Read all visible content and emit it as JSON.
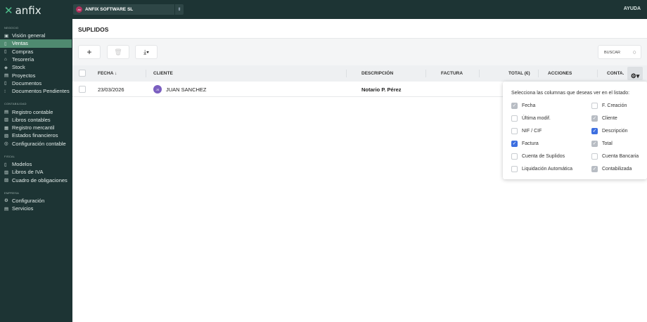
{
  "app": {
    "logo": "anfix",
    "company": "ANFIX SOFTWARE SL",
    "company_initials": "AS",
    "help": "AYUDA"
  },
  "sidebar": {
    "sections": [
      {
        "label": "NEGOCIO",
        "items": [
          {
            "label": "Visión general",
            "icon": "chart-icon"
          },
          {
            "label": "Ventas",
            "icon": "document-icon",
            "active": true
          },
          {
            "label": "Compras",
            "icon": "document-icon"
          },
          {
            "label": "Tesorería",
            "icon": "bank-icon"
          },
          {
            "label": "Stock",
            "icon": "box-icon"
          },
          {
            "label": "Proyectos",
            "icon": "folder-icon"
          },
          {
            "label": "Documentos",
            "icon": "file-icon"
          },
          {
            "label": "Documentos Pendientes",
            "icon": "scan-icon"
          }
        ]
      },
      {
        "label": "CONTABILIDAD",
        "items": [
          {
            "label": "Registro contable",
            "icon": "ledger-icon"
          },
          {
            "label": "Libros contables",
            "icon": "book-icon"
          },
          {
            "label": "Registro mercantil",
            "icon": "registry-icon"
          },
          {
            "label": "Estados financieros",
            "icon": "report-icon"
          },
          {
            "label": "Configuración contable",
            "icon": "settings-icon"
          }
        ]
      },
      {
        "label": "FISCAL",
        "items": [
          {
            "label": "Modelos",
            "icon": "file-icon"
          },
          {
            "label": "Libros de IVA",
            "icon": "book-icon"
          },
          {
            "label": "Cuadro de obligaciones",
            "icon": "calendar-icon"
          }
        ]
      },
      {
        "label": "EMPRESA",
        "items": [
          {
            "label": "Configuración",
            "icon": "gear-icon"
          },
          {
            "label": "Servicios",
            "icon": "services-icon"
          }
        ]
      }
    ]
  },
  "page": {
    "title": "SUPLIDOS",
    "search_label": "BUSCAR"
  },
  "table": {
    "columns": {
      "fecha": "FECHA ↓",
      "cliente": "CLIENTE",
      "descripcion": "DESCRIPCIÓN",
      "factura": "FACTURA",
      "total": "TOTAL (€)",
      "acciones": "ACCIONES",
      "conta": "CONTA."
    },
    "rows": [
      {
        "fecha": "23/03/2026",
        "cliente_initials": "JS",
        "cliente": "JUAN SANCHEZ",
        "descripcion": "Notario P. Pérez",
        "factura": "",
        "total": ""
      }
    ]
  },
  "column_picker": {
    "heading": "Selecciona las columnas que deseas ver en el listado:",
    "options": [
      {
        "label": "Fecha",
        "state": "disabled-checked"
      },
      {
        "label": "F. Creación",
        "state": "unchecked"
      },
      {
        "label": "Última modif.",
        "state": "unchecked"
      },
      {
        "label": "Cliente",
        "state": "disabled-checked"
      },
      {
        "label": "NIF / CIF",
        "state": "unchecked"
      },
      {
        "label": "Descripción",
        "state": "checked"
      },
      {
        "label": "Factura",
        "state": "checked"
      },
      {
        "label": "Total",
        "state": "disabled-checked"
      },
      {
        "label": "Cuenta de Suplidos",
        "state": "unchecked"
      },
      {
        "label": "Cuenta Bancaria",
        "state": "unchecked"
      },
      {
        "label": "Liquidación Automática",
        "state": "unchecked"
      },
      {
        "label": "Contabilizada",
        "state": "disabled-checked"
      }
    ]
  },
  "colors": {
    "sidebar": "#1d3434",
    "active": "#4f8a70",
    "checked": "#3d6fe0"
  }
}
